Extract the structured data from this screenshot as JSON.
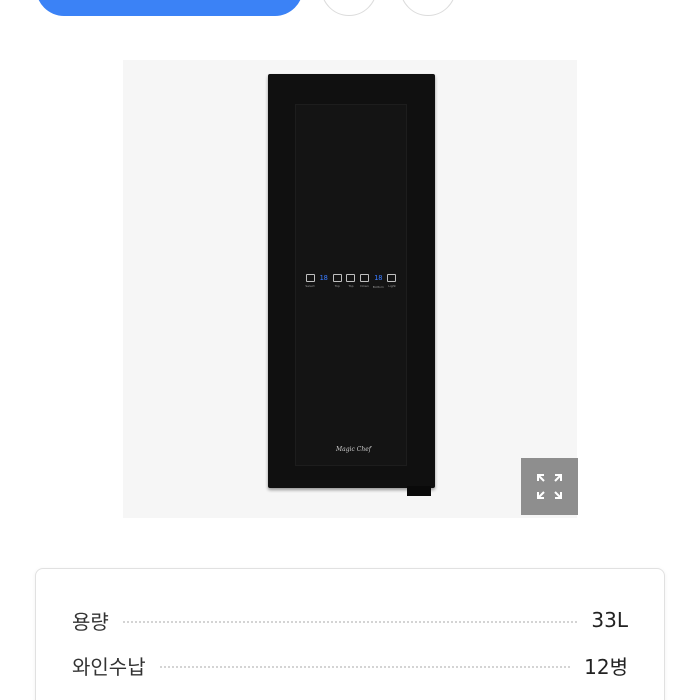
{
  "colors": {
    "primary_button": "#3b82f6",
    "fridge_body": "#101010",
    "display_digits": "#3a7bff",
    "expand_button": "#8e8e8e"
  },
  "product_image": {
    "brand": "Magic Chef",
    "panel": {
      "labels": [
        "Select",
        "Top",
        "Top",
        "Down",
        "Bottom",
        "Light"
      ],
      "display_top": "18",
      "display_bottom": "18"
    },
    "expand_icon": "expand-icon"
  },
  "specs": [
    {
      "label": "용량",
      "value": "33L"
    },
    {
      "label": "와인수납",
      "value": "12병"
    },
    {
      "label": "",
      "value": ""
    }
  ]
}
